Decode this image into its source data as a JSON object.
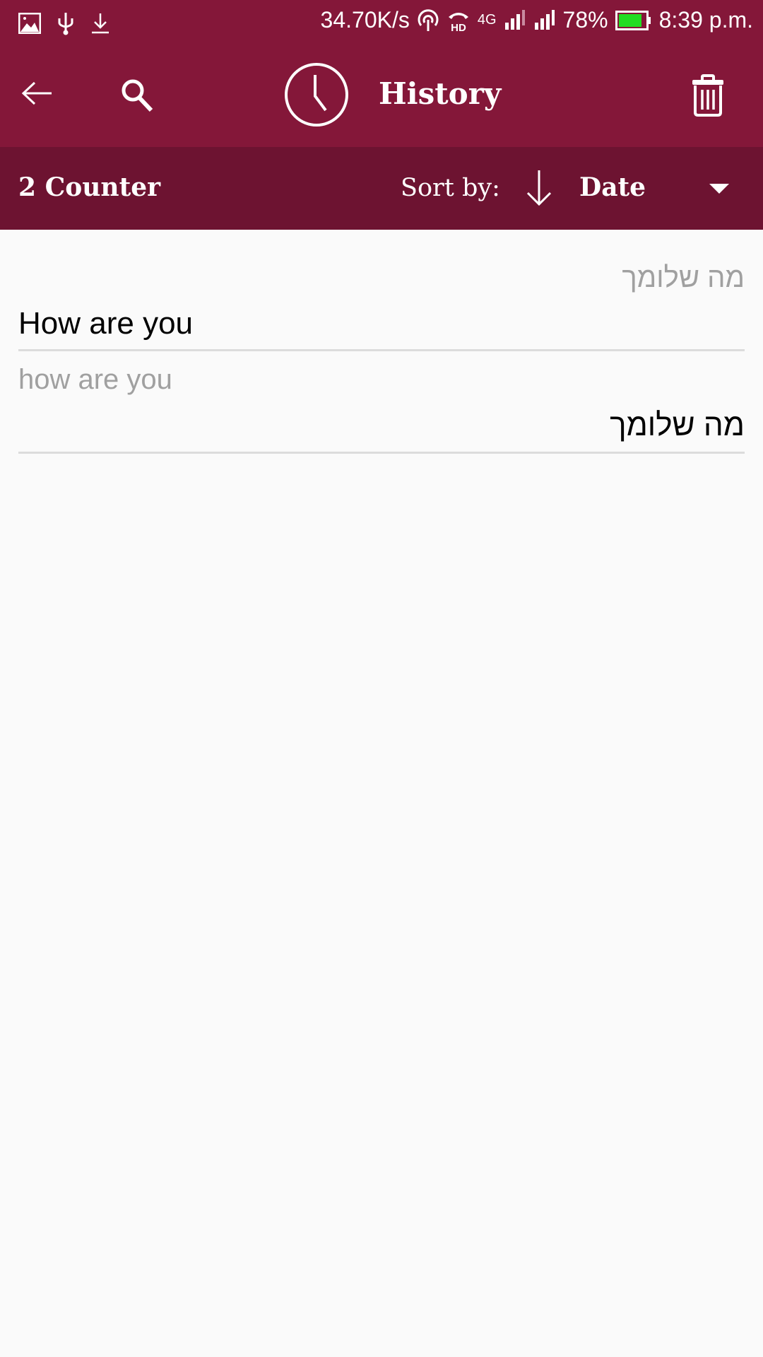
{
  "status_bar": {
    "left_icons": [
      "gallery-icon",
      "usb-icon",
      "download-icon"
    ],
    "network_speed": "34.70K/s",
    "right_icons": [
      "hotspot-icon",
      "hd-call-icon",
      "4g-signal-icon",
      "signal-icon"
    ],
    "network_type": "4G",
    "battery": "78%",
    "battery_color": "#22dd22",
    "time": "8:39 p.m."
  },
  "app_bar": {
    "title": "History",
    "icons": [
      "back-arrow-icon",
      "search-icon",
      "clock-icon",
      "trash-icon"
    ],
    "color": "#841739"
  },
  "sub_bar": {
    "counter": "2 Counter",
    "sort_label": "Sort by:",
    "sort_value": "Date",
    "color": "#6d1331"
  },
  "history": [
    {
      "source": "מה שלומך",
      "translation": "How are you",
      "source_dir": "rtl",
      "translation_dir": "ltr"
    },
    {
      "source": "how are you",
      "translation": "מה שלומך",
      "source_dir": "ltr",
      "translation_dir": "rtl"
    }
  ]
}
